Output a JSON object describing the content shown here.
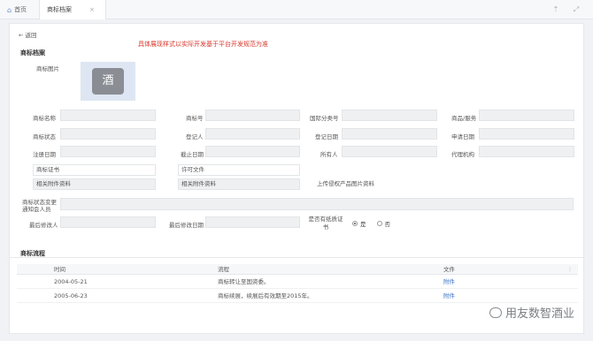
{
  "tabs": {
    "home_label": "首页",
    "active_label": "商标档案"
  },
  "page": {
    "back_label": "返回",
    "notice": "具体展现样式以实际开发基于平台开发规范为准",
    "section_title": "商标档案",
    "image_label": "商标图片",
    "image_char": "酒"
  },
  "fields": {
    "row1": [
      "商标名称",
      "商标号",
      "国际分类号",
      "商品/服务"
    ],
    "row2": [
      "商标状态",
      "登记人",
      "登记日期",
      "申请日期"
    ],
    "row3": [
      "注册日期",
      "截止日期",
      "所有人",
      "代理机构"
    ],
    "certificate": "商标证书",
    "license": "许可文件",
    "related_attachment": "相关附件资料",
    "upload_label": "上传侵权产品图片资料",
    "status_change_notify": "商标状态变更通知会人员",
    "last_modifier": "最后修改人",
    "last_modified_date": "最后修改日期",
    "paper_cert": "是否有纸质证书",
    "radio_yes": "是",
    "radio_no": "否"
  },
  "flow": {
    "title": "商标流程",
    "columns": [
      "时间",
      "流程",
      "文件"
    ],
    "rows": [
      {
        "time": "2004-05-21",
        "process": "商标转让至国资委。",
        "file": "附件"
      },
      {
        "time": "2005-06-23",
        "process": "商标续展，续展后有效期至2015年。",
        "file": "附件"
      }
    ]
  },
  "watermark": "用友数智酒业",
  "colors": {
    "notice": "#d9362b",
    "link": "#3a72c8"
  }
}
